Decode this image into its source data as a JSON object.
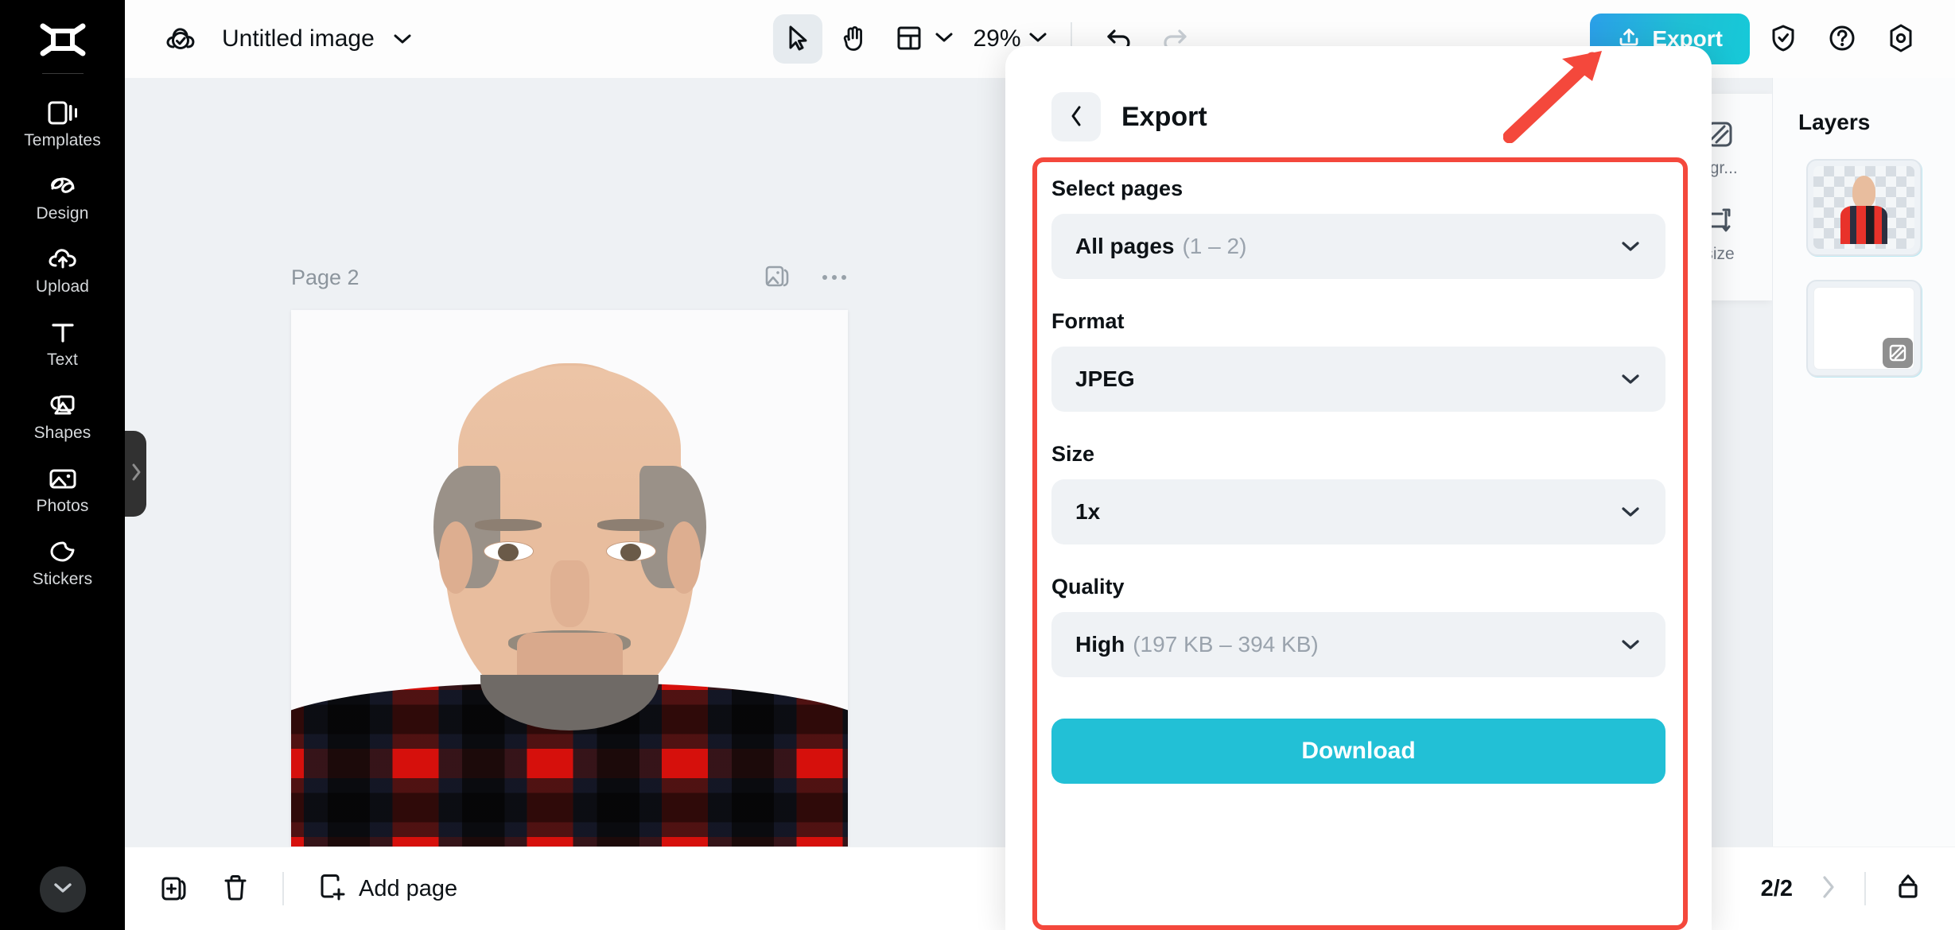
{
  "app": {
    "logo_icon": "capcut-logo-icon"
  },
  "sidebar": {
    "items": [
      {
        "label": "Templates",
        "icon": "templates-icon"
      },
      {
        "label": "Design",
        "icon": "design-icon"
      },
      {
        "label": "Upload",
        "icon": "upload-cloud-icon"
      },
      {
        "label": "Text",
        "icon": "text-icon"
      },
      {
        "label": "Shapes",
        "icon": "shapes-icon"
      },
      {
        "label": "Photos",
        "icon": "photos-icon"
      },
      {
        "label": "Stickers",
        "icon": "stickers-icon"
      }
    ],
    "more_icon": "chevron-down-icon",
    "expand_handle_icon": "chevron-right-icon"
  },
  "topbar": {
    "save_icon": "cloud-saved-icon",
    "title": "Untitled image",
    "title_caret_icon": "chevron-down-icon",
    "tools": [
      {
        "name": "select-tool",
        "icon": "cursor-arrow-icon",
        "active": true
      },
      {
        "name": "hand-tool",
        "icon": "hand-icon",
        "active": false
      },
      {
        "name": "layout-tool",
        "icon": "layout-grid-icon",
        "active": false
      }
    ],
    "layout_caret_icon": "chevron-down-icon",
    "zoom_level": "29%",
    "zoom_caret_icon": "chevron-down-icon",
    "undo_icon": "undo-arrow-icon",
    "redo_icon": "redo-arrow-icon",
    "export_label": "Export",
    "export_icon": "export-upload-icon",
    "export_gradient_from": "#2b9fe8",
    "export_gradient_to": "#16c9d8",
    "right_icons": [
      {
        "name": "shield-check-icon"
      },
      {
        "name": "help-question-icon"
      },
      {
        "name": "settings-gear-icon"
      }
    ]
  },
  "canvas": {
    "page_label": "Page 2",
    "page_duplicate_icon": "duplicate-image-icon",
    "page_more_icon": "ellipsis-icon"
  },
  "tool_strip": {
    "items": [
      {
        "label": "kgr...",
        "icon": "remove-background-icon"
      },
      {
        "label": "size",
        "icon": "resize-icon"
      }
    ]
  },
  "layers": {
    "title": "Layers",
    "items": [
      {
        "name": "portrait-layer",
        "type": "image"
      },
      {
        "name": "background-layer",
        "type": "blank",
        "badge_icon": "background-icon"
      }
    ]
  },
  "bottombar": {
    "duplicate_icon": "duplicate-page-icon",
    "delete_icon": "trash-icon",
    "add_page_icon": "add-page-icon",
    "add_page_label": "Add page",
    "page_indicator": "2/2",
    "next_page_icon": "chevron-right-icon",
    "share_icon": "share-upload-icon"
  },
  "export_panel": {
    "back_icon": "chevron-left-icon",
    "title": "Export",
    "fields": [
      {
        "label": "Select pages",
        "value": "All pages",
        "sub": "(1 – 2)",
        "caret_icon": "chevron-down-icon"
      },
      {
        "label": "Format",
        "value": "JPEG",
        "sub": "",
        "caret_icon": "chevron-down-icon"
      },
      {
        "label": "Size",
        "value": "1x",
        "sub": "",
        "caret_icon": "chevron-down-icon"
      },
      {
        "label": "Quality",
        "value": "High",
        "sub": "(197 KB – 394 KB)",
        "caret_icon": "chevron-down-icon"
      }
    ],
    "download_label": "Download",
    "download_color": "#22c0d6"
  },
  "annotations": {
    "highlight_color": "#f4483c",
    "arrow_target": "export-button"
  }
}
